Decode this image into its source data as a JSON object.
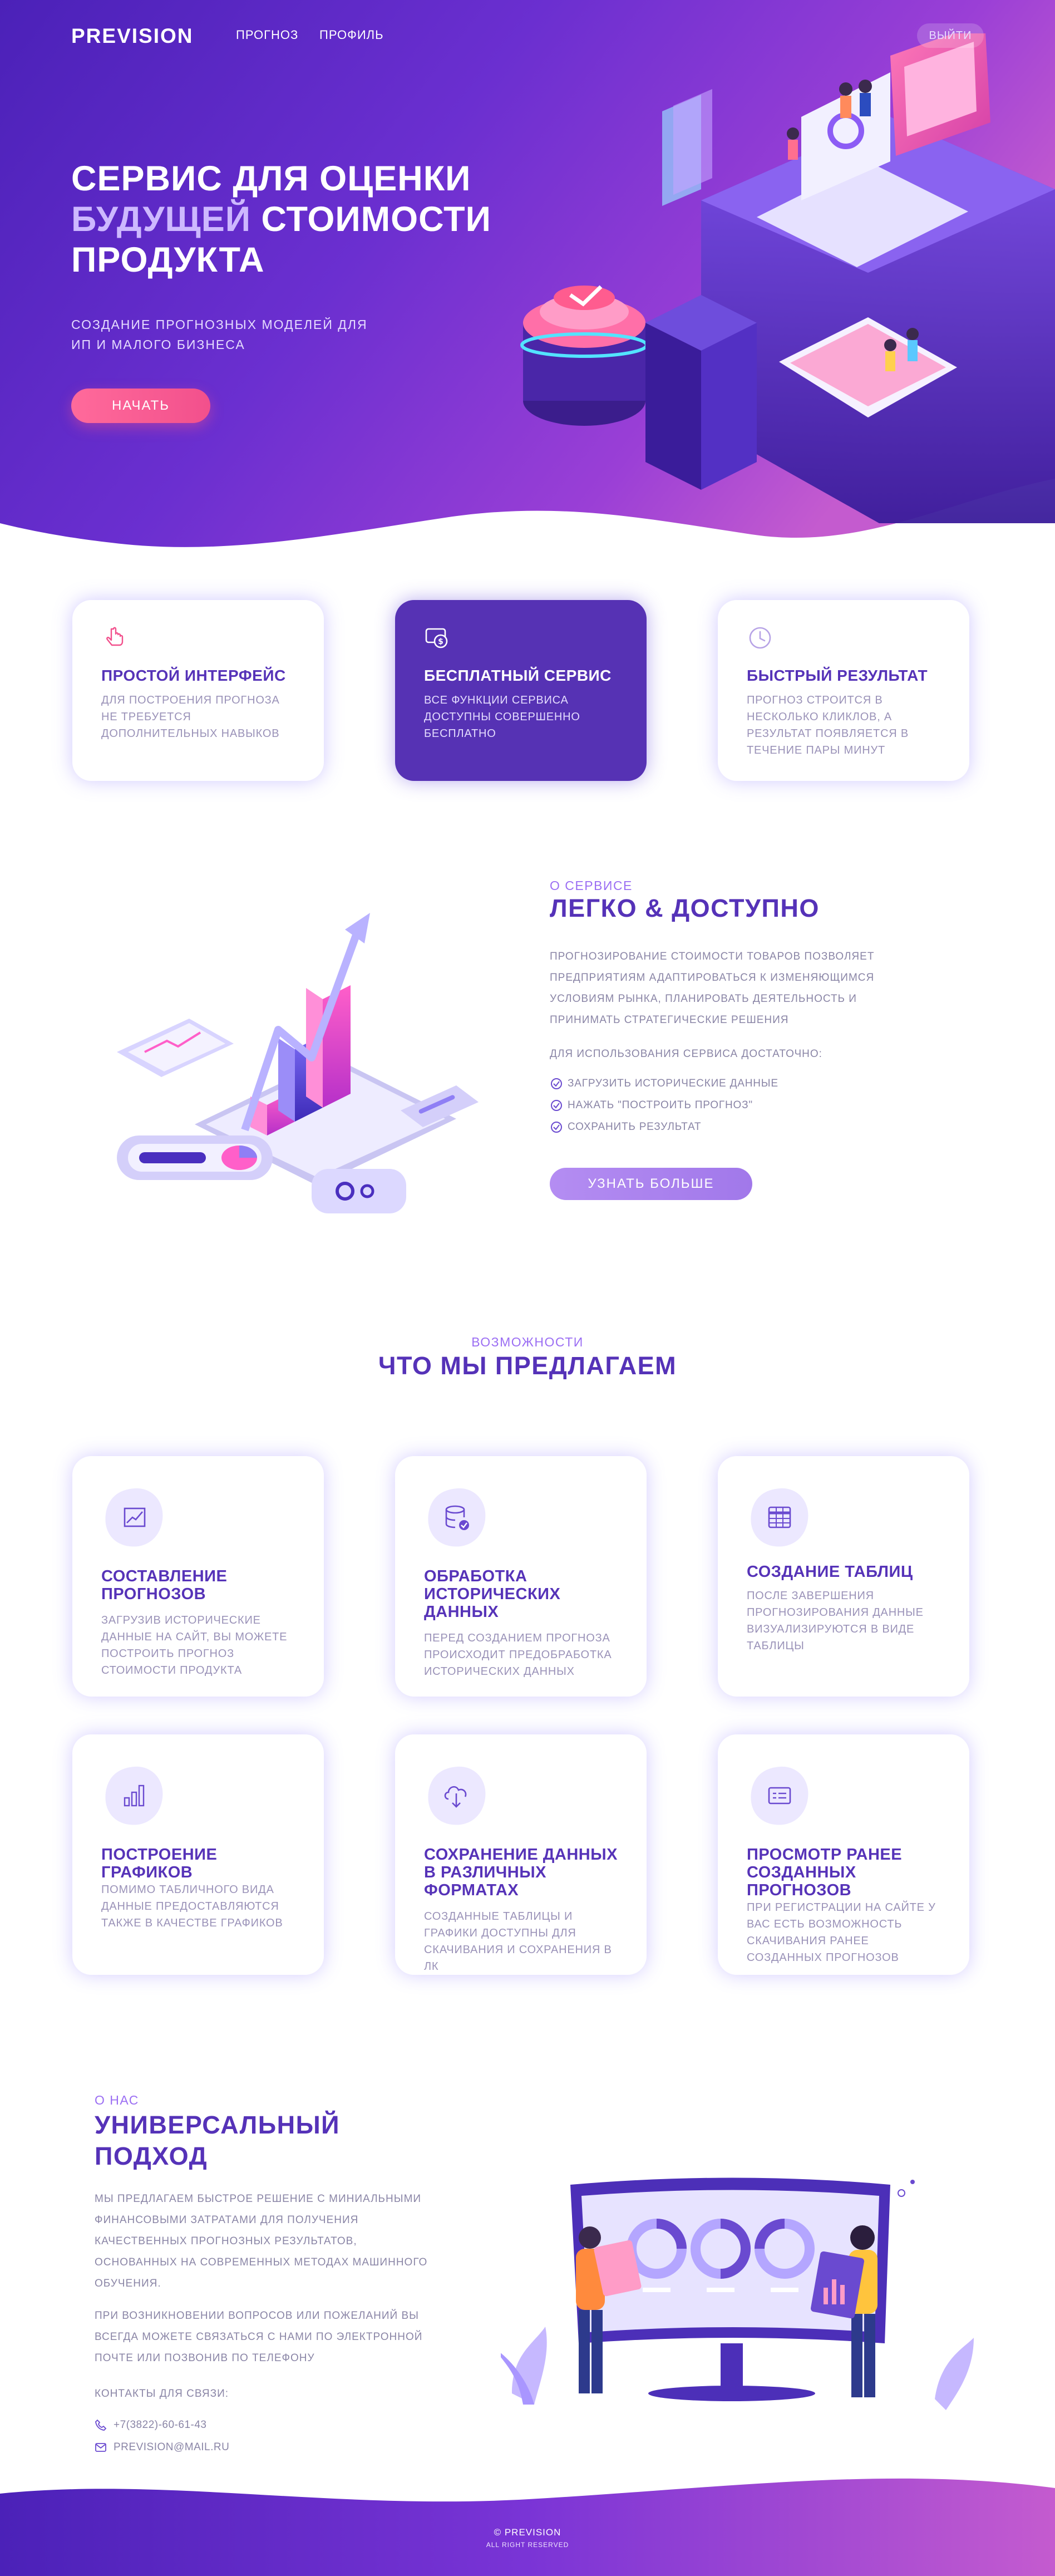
{
  "nav": {
    "logo": "PREVISION",
    "links": [
      "ПРОГНОЗ",
      "ПРОФИЛЬ"
    ],
    "logout": "ВЫЙТИ"
  },
  "hero": {
    "title_line1": "СЕРВИС ДЛЯ ОЦЕНКИ",
    "title_accent": "БУДУЩЕЙ",
    "title_line2_rest": " СТОИМОСТИ",
    "title_line3": "ПРОДУКТА",
    "subtitle": "СОЗДАНИЕ ПРОГНОЗНЫХ МОДЕЛЕЙ ДЛЯ ИП И МАЛОГО БИЗНЕСА",
    "cta": "НАЧАТЬ"
  },
  "features": [
    {
      "title": "ПРОСТОЙ ИНТЕРФЕЙС",
      "text": "ДЛЯ ПОСТРОЕНИЯ ПРОГНОЗА НЕ ТРЕБУЕТСЯ ДОПОЛНИТЕЛЬНЫХ НАВЫКОВ",
      "icon": "hand-pointer-icon"
    },
    {
      "title": "БЕСПЛАТНЫЙ СЕРВИС",
      "text": "ВСЕ ФУНКЦИИ СЕРВИСА ДОСТУПНЫ СОВЕРШЕННО БЕСПЛАТНО",
      "icon": "money-icon"
    },
    {
      "title": "БЫСТРЫЙ РЕЗУЛЬТАТ",
      "text": "ПРОГНОЗ СТРОИТСЯ В НЕСКОЛЬКО КЛИКЛОВ, А РЕЗУЛЬТАТ ПОЯВЛЯЕТСЯ В ТЕЧЕНИЕ ПАРЫ МИНУТ",
      "icon": "clock-icon"
    }
  ],
  "about_service": {
    "eyebrow": "О СЕРВИСЕ",
    "title": "ЛЕГКО & ДОСТУПНО",
    "paragraph": "ПРОГНОЗИРОВАНИЕ СТОИМОСТИ ТОВАРОВ ПОЗВОЛЯЕТ ПРЕДПРИЯТИЯМ АДАПТИРОВАТЬСЯ К ИЗМЕНЯЮЩИМСЯ УСЛОВИЯМ РЫНКА, ПЛАНИРОВАТЬ ДЕЯТЕЛЬНОСТЬ И ПРИНИМАТЬ СТРАТЕГИЧЕСКИЕ РЕШЕНИЯ",
    "steps_intro": "ДЛЯ ИСПОЛЬЗОВАНИЯ СЕРВИСА ДОСТАТОЧНО:",
    "steps": [
      "ЗАГРУЗИТЬ ИСТОРИЧЕСКИЕ ДАННЫЕ",
      "НАЖАТЬ \"ПОСТРОИТЬ ПРОГНОЗ\"",
      "СОХРАНИТЬ РЕЗУЛЬТАТ"
    ],
    "button": "УЗНАТЬ БОЛЬШЕ"
  },
  "offers": {
    "eyebrow": "ВОЗМОЖНОСТИ",
    "title": "ЧТО МЫ ПРЕДЛАГАЕМ",
    "items": [
      {
        "title": "СОСТАВЛЕНИЕ ПРОГНОЗОВ",
        "text": "ЗАГРУЗИВ ИСТОРИЧЕСКИЕ ДАННЫЕ НА САЙТ, ВЫ МОЖЕТЕ ПОСТРОИТЬ ПРОГНОЗ СТОИМОСТИ ПРОДУКТА",
        "icon": "trend-chart-icon"
      },
      {
        "title": "ОБРАБОТКА ИСТОРИЧЕСКИХ ДАННЫХ",
        "text": "ПЕРЕД СОЗДАНИЕМ ПРОГНОЗА ПРОИСХОДИТ ПРЕДОБРАБОТКА ИСТОРИЧЕСКИХ ДАННЫХ",
        "icon": "database-check-icon"
      },
      {
        "title": "СОЗДАНИЕ ТАБЛИЦ",
        "text": "ПОСЛЕ ЗАВЕРШЕНИЯ ПРОГНОЗИРОВАНИЯ ДАННЫЕ ВИЗУАЛИЗИРУЮТСЯ В ВИДЕ ТАБЛИЦЫ",
        "icon": "table-icon"
      },
      {
        "title": "ПОСТРОЕНИЕ ГРАФИКОВ",
        "text": "ПОМИМО ТАБЛИЧНОГО ВИДА ДАННЫЕ ПРЕДОСТАВЛЯЮТСЯ ТАКЖЕ В КАЧЕСТВЕ ГРАФИКОВ",
        "icon": "bar-chart-icon"
      },
      {
        "title": "СОХРАНЕНИЕ ДАННЫХ В РАЗЛИЧНЫХ ФОРМАТАХ",
        "text": "СОЗДАННЫЕ ТАБЛИЦЫ И ГРАФИКИ ДОСТУПНЫ ДЛЯ СКАЧИВАНИЯ И СОХРАНЕНИЯ В ЛК",
        "icon": "cloud-download-icon"
      },
      {
        "title": "ПРОСМОТР РАНЕЕ СОЗДАННЫХ ПРОГНОЗОВ",
        "text": "ПРИ РЕГИСТРАЦИИ НА САЙТЕ У ВАС ЕСТЬ ВОЗМОЖНОСТЬ СКАЧИВАНИЯ РАНЕЕ СОЗДАННЫХ ПРОГНОЗОВ",
        "icon": "list-card-icon"
      }
    ]
  },
  "universal": {
    "eyebrow": "О НАС",
    "title_line1": "УНИВЕРСАЛЬНЫЙ",
    "title_line2": "ПОДХОД",
    "paragraph1": "МЫ ПРЕДЛАГАЕМ БЫСТРОЕ РЕШЕНИЕ С МИНИАЛЬНЫМИ ФИНАНСОВЫМИ ЗАТРАТАМИ ДЛЯ ПОЛУЧЕНИЯ КАЧЕСТВЕННЫХ ПРОГНОЗНЫХ РЕЗУЛЬТАТОВ, ОСНОВАННЫХ НА СОВРЕМЕННЫХ МЕТОДАХ МАШИННОГО ОБУЧЕНИЯ.",
    "paragraph2": "ПРИ ВОЗНИКНОВЕНИИ ВОПРОСОВ ИЛИ ПОЖЕЛАНИЙ ВЫ ВСЕГДА МОЖЕТЕ СВЯЗАТЬСЯ С НАМИ ПО ЭЛЕКТРОННОЙ ПОЧТЕ ИЛИ ПОЗВОНИВ ПО ТЕЛЕФОНУ",
    "contacts_label": "КОНТАКТЫ ДЛЯ СВЯЗИ:",
    "phone": "+7(3822)-60-61-43",
    "email": "PREVISION@MAIL.RU"
  },
  "footer": {
    "copyright": "© PREVISION",
    "rights": "ALL RIGHT RESERVED"
  },
  "colors": {
    "primary": "#5632b4",
    "accent_pink": "#f2508c",
    "lavender": "#b48df2",
    "text_muted": "#9a92b8"
  }
}
